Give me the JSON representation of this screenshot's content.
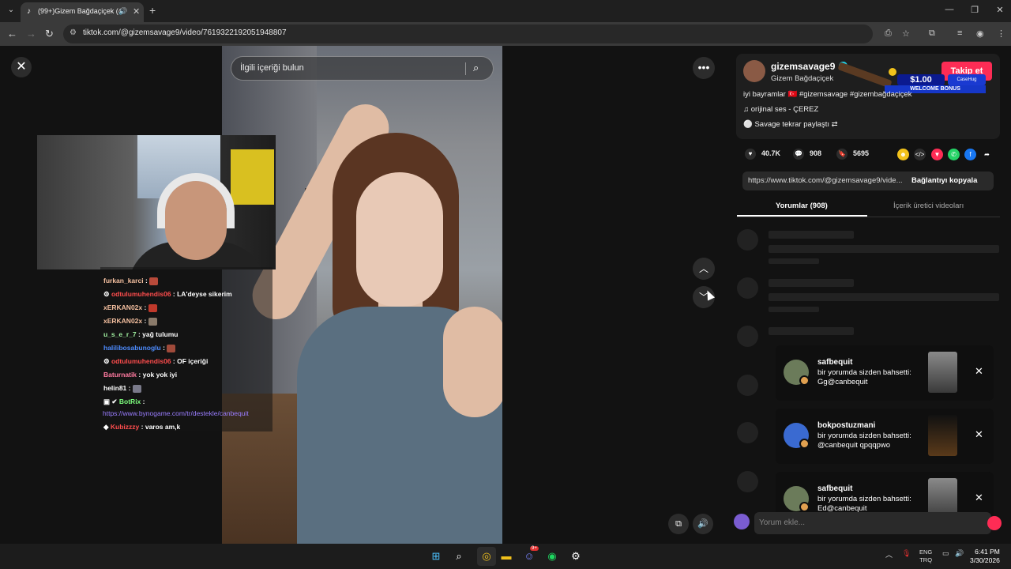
{
  "browser": {
    "tab_title": "(99+)Gizem Bağdaçiçek (@",
    "new_tab": "+",
    "url": "tiktok.com/@gizemsavage9/video/7619322192051948807"
  },
  "viewer": {
    "search_placeholder": "İlgili içeriği bulun"
  },
  "chat": [
    {
      "user": "furkan_karci",
      "msg": ":",
      "color": "#f5c0a0"
    },
    {
      "user": "odtulumuhendis06",
      "msg": ": LA'deyse sikerim",
      "color": "#ff4d4d"
    },
    {
      "user": "xERKAN02x",
      "msg": ":",
      "color": "#f5c0a0"
    },
    {
      "user": "xERKAN02x",
      "msg": ":",
      "color": "#f5c0a0"
    },
    {
      "user": "u_s_e_r_7",
      "msg": ": yağ tulumu",
      "color": "#a0f0a0"
    },
    {
      "user": "halilibosabunoglu",
      "msg": ":",
      "color": "#4d8cff"
    },
    {
      "user": "odtulumuhendis06",
      "msg": ": OF içeriği",
      "color": "#ff4d4d"
    },
    {
      "user": "Baturnatik",
      "msg": ": yok yok iyi",
      "color": "#ff7aa0"
    },
    {
      "user": "helin81",
      "msg": ":",
      "color": "#ffffff"
    },
    {
      "user": "BotRix",
      "msg": ":",
      "color": "#7dff7d"
    },
    {
      "user": "https://www.bynogame.com/tr/destekle/canbequit",
      "msg": "",
      "color": "#9a7dff"
    },
    {
      "user": "Kubizzzy",
      "msg": ": varos am,k",
      "color": "#ff4d4d"
    }
  ],
  "profile": {
    "username": "gizemsavage9",
    "display_name": "Gizem Bağdaçiçek",
    "follow": "Takip et",
    "description": "iyi bayramlar 🇹🇷 #gizemsavage #gizembağdaçiçek",
    "sound": "♫ orijinal ses - ÇEREZ",
    "repost": "Savage tekrar paylaştı",
    "ad_amount": "$1.00",
    "ad_bonus": "WELCOME BONUS",
    "ad_brand": "CaseHug"
  },
  "stats": {
    "likes": "40.7K",
    "comments": "908",
    "saves": "5695"
  },
  "link": {
    "url": "https://www.tiktok.com/@gizemsavage9/vide...",
    "copy": "Bağlantıyı kopyala"
  },
  "tabs": {
    "comments": "Yorumlar (908)",
    "creator_videos": "İçerik üretici videoları"
  },
  "comment_placeholder": "Yorum ekle...",
  "notifications": [
    {
      "user": "safbequit",
      "line1": "bir yorumda sizden bahsetti:",
      "line2": "Gg@canbequit"
    },
    {
      "user": "bokpostuzmani",
      "line1": "bir yorumda sizden bahsetti:",
      "line2": "@canbequit qpqqpwo"
    },
    {
      "user": "safbequit",
      "line1": "bir yorumda sizden bahsetti:",
      "line2": "Ed@canbequit"
    }
  ],
  "taskbar": {
    "lang_top": "ENG",
    "lang_bottom": "TRQ",
    "time": "6:41 PM",
    "date": "3/30/2026",
    "discord_badge": "9+"
  }
}
